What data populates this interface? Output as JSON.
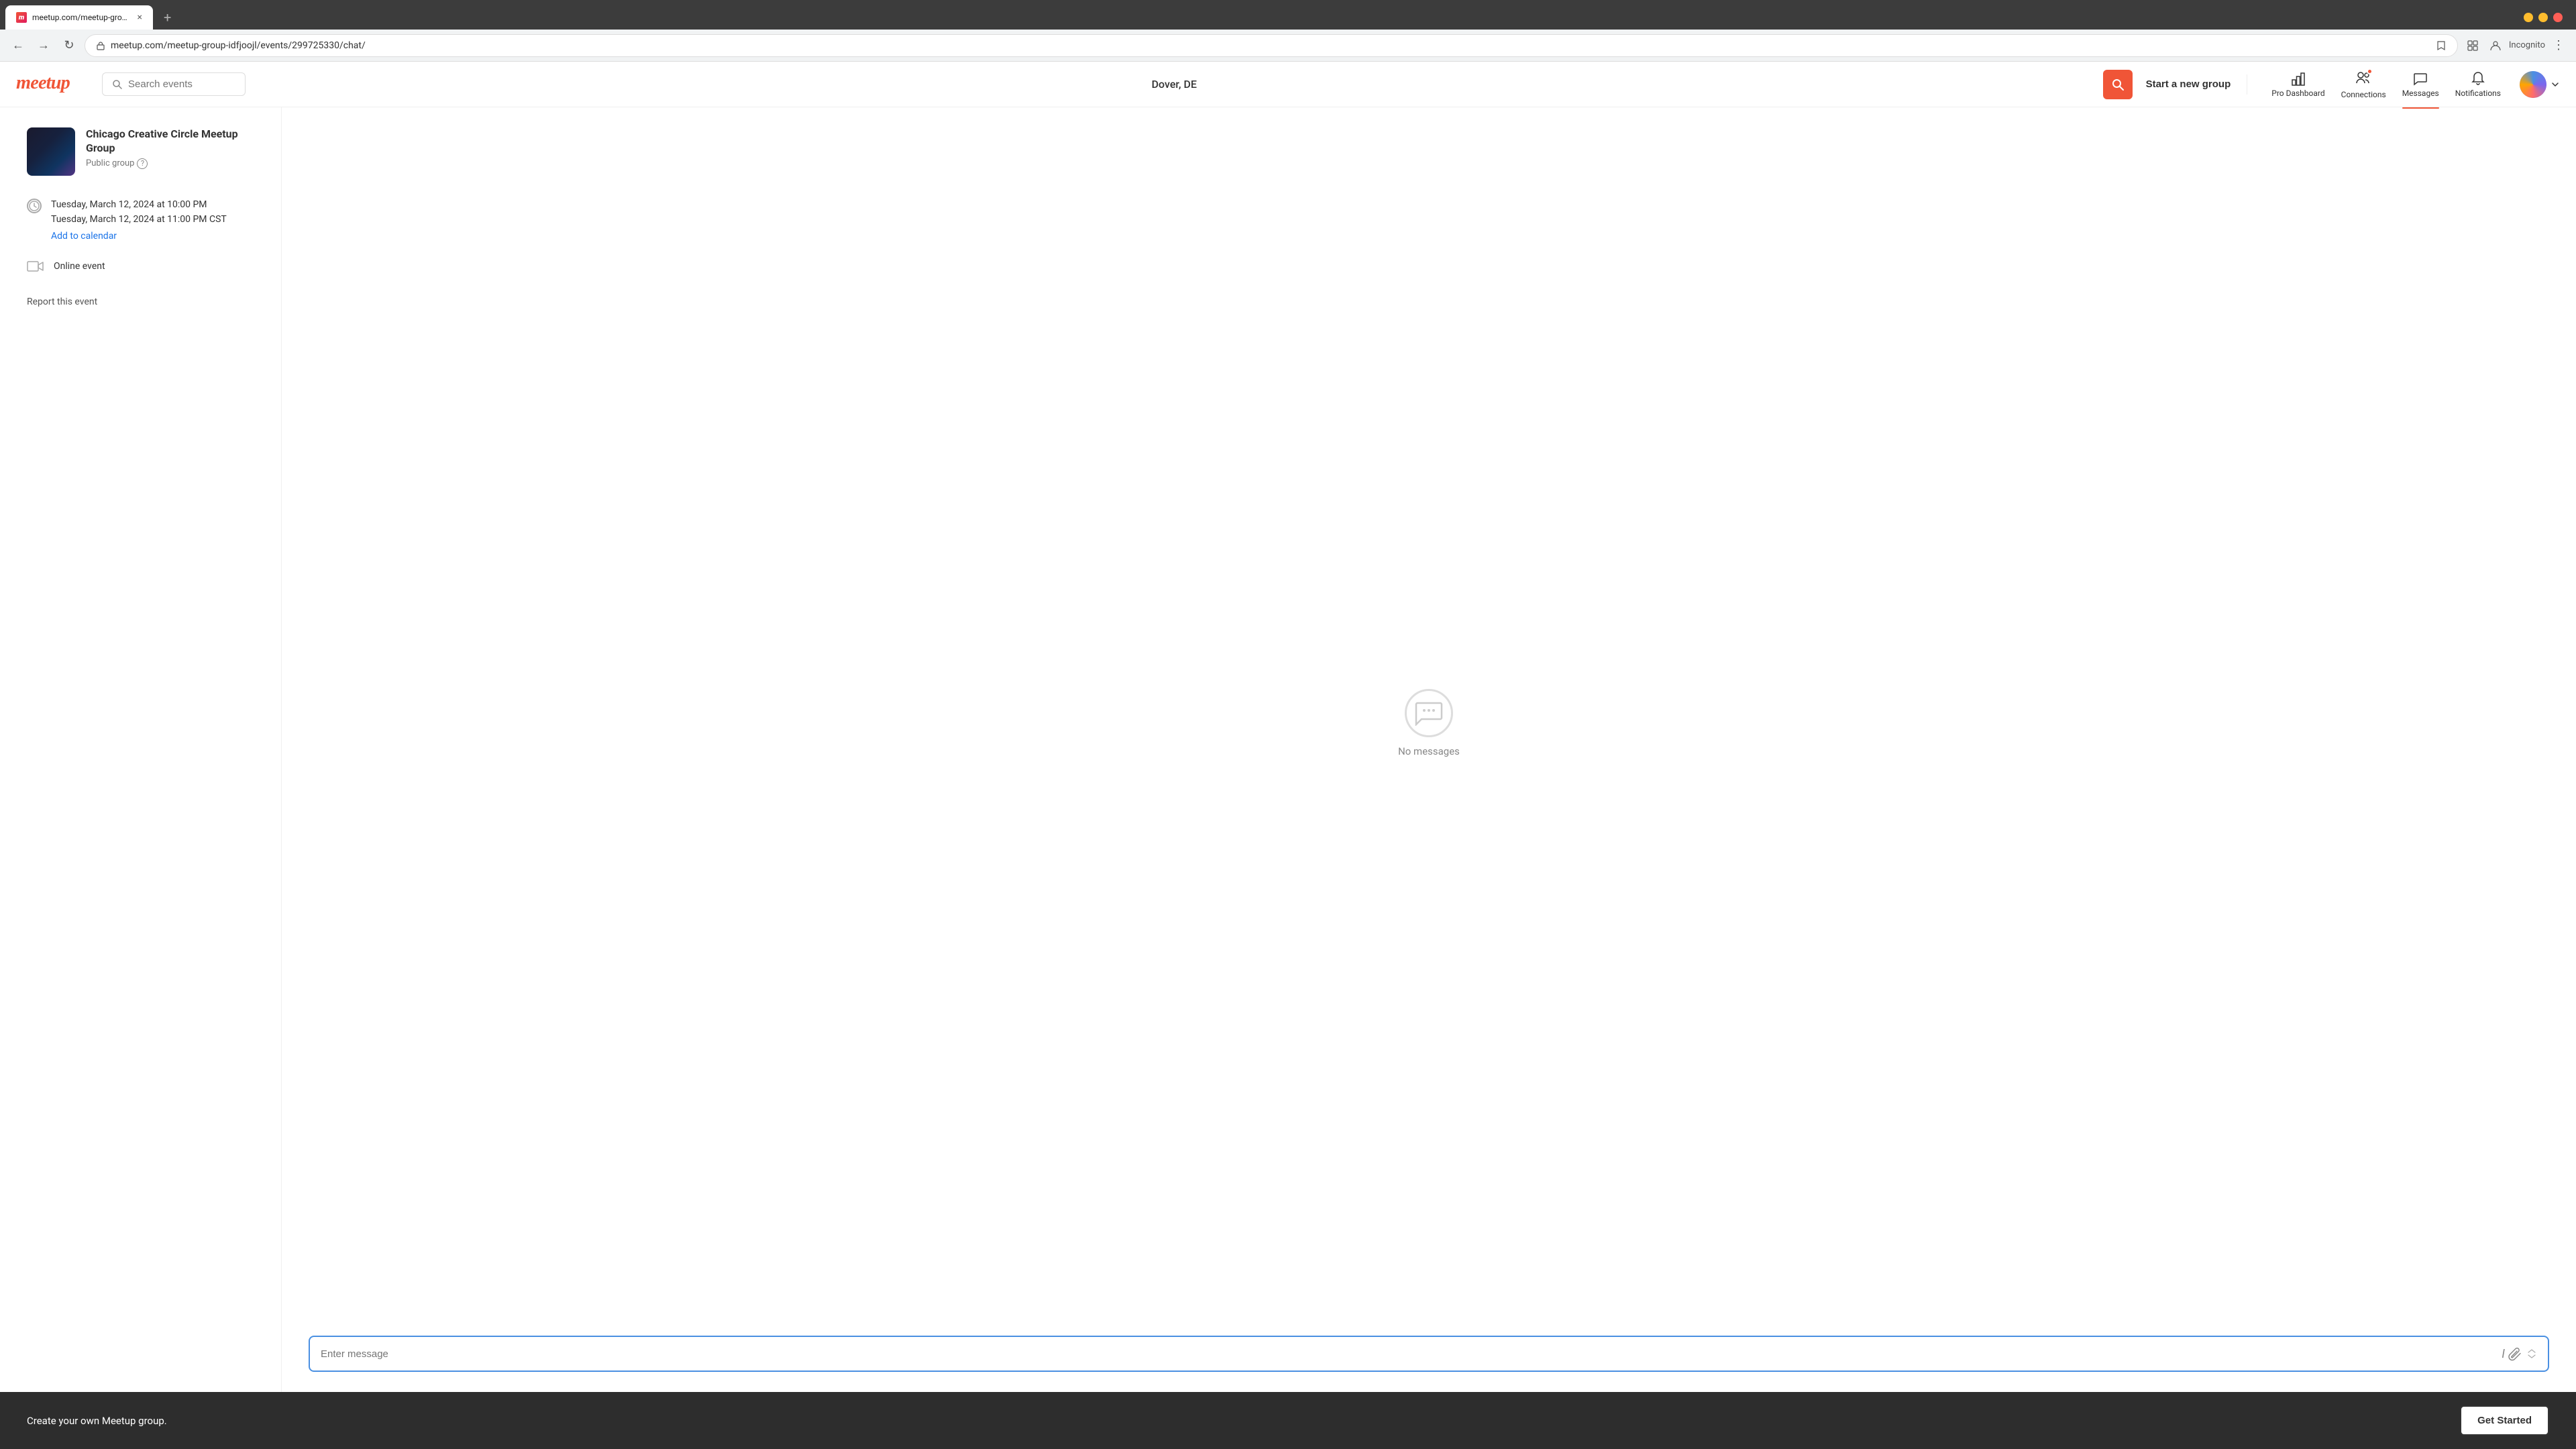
{
  "browser": {
    "tab": {
      "title": "meetup.com/meetup-group-id...",
      "favicon": "M"
    },
    "url": "meetup.com/meetup-group-idfjoojl/events/299725330/chat/",
    "new_tab_label": "+",
    "controls": {
      "minimize": "−",
      "maximize": "□",
      "close": "×"
    },
    "toolbar": {
      "back": "←",
      "forward": "→",
      "refresh": "↻",
      "search_icon": "🔍",
      "bookmark_icon": "☆",
      "extensions_icon": "🧩",
      "profile_icon": "👤",
      "incognito_label": "Incognito",
      "more_icon": "⋮"
    }
  },
  "header": {
    "logo": "meetup",
    "search_placeholder": "Search events",
    "location": "Dover, DE",
    "search_btn_icon": "🔍",
    "start_new_group": "Start a new group",
    "nav": {
      "pro_dashboard": {
        "label": "Pro Dashboard",
        "icon": "📊"
      },
      "connections": {
        "label": "Connections",
        "icon": "👤",
        "badge": true
      },
      "messages": {
        "label": "Messages",
        "icon": "💬",
        "active": true
      },
      "notifications": {
        "label": "Notifications",
        "icon": "🔔"
      }
    }
  },
  "event": {
    "group": {
      "name": "Chicago Creative Circle Meetup Group",
      "type": "Public group"
    },
    "datetime": {
      "start": "Tuesday, March 12, 2024 at 10:00 PM",
      "end": "Tuesday, March 12, 2024 at 11:00 PM CST",
      "timezone": "CST"
    },
    "add_calendar": "Add to calendar",
    "online_event": "Online event",
    "report": "Report this event"
  },
  "chat": {
    "no_messages": "No messages",
    "message_placeholder": "Enter message"
  },
  "footer": {
    "text": "Create your own Meetup group.",
    "button": "Get Started"
  }
}
